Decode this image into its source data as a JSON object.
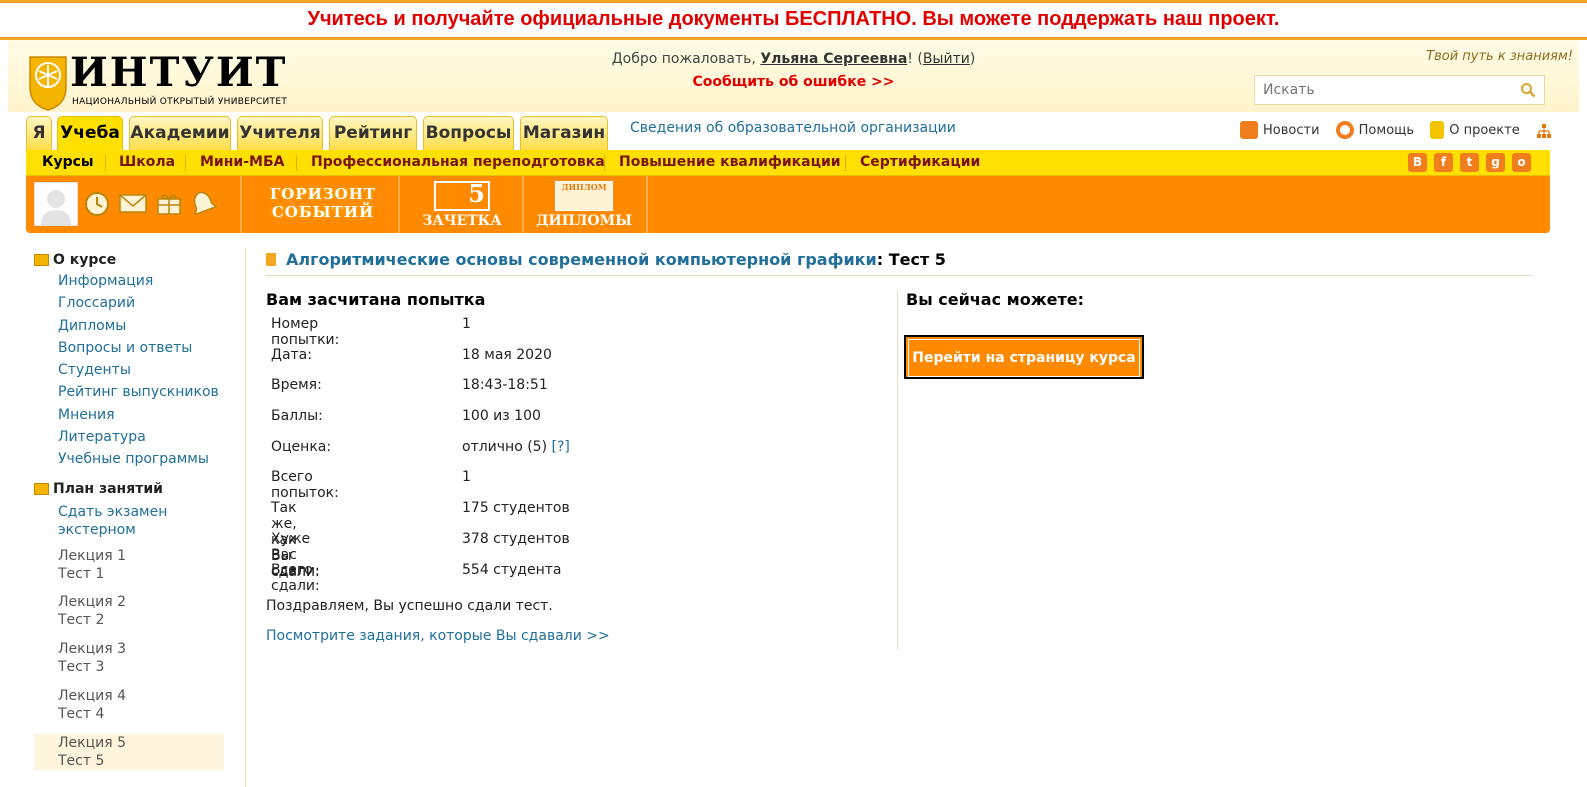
{
  "promo": {
    "text": "Учитесь и получайте официальные документы БЕСПЛАТНО. Вы можете поддержать наш проект."
  },
  "header": {
    "logo_title": "ИНТУИТ",
    "logo_subtitle": "НАЦИОНАЛЬНЫЙ ОТКРЫТЫЙ УНИВЕРСИТЕТ",
    "welcome_prefix": "Добро пожаловать, ",
    "user_name": "Ульяна Сергеевна",
    "welcome_excl": "! (",
    "exit_label": "Выйти",
    "welcome_close": ")",
    "report_error": "Сообщить об ошибке >>",
    "tagline": "Твой путь к знаниям!",
    "search_placeholder": "Искать"
  },
  "tabs": [
    {
      "label": "Я"
    },
    {
      "label": "Учеба",
      "active": true
    },
    {
      "label": "Академии"
    },
    {
      "label": "Учителя"
    },
    {
      "label": "Рейтинг"
    },
    {
      "label": "Вопросы"
    },
    {
      "label": "Магазин"
    }
  ],
  "info_link": "Сведения об образовательной организации",
  "right_links": {
    "news": "Новости",
    "help": "Помощь",
    "about": "О проекте"
  },
  "submenu": [
    "Курсы",
    "Школа",
    "Мини-МБА",
    "Профессиональная переподготовка",
    "Повышение квалификации",
    "Сертификации"
  ],
  "social": [
    "В",
    "f",
    "t",
    "g",
    "о"
  ],
  "toolbar": {
    "horizon_line1": "ГОРИЗОНТ",
    "horizon_line2": "СОБЫТИЙ",
    "zachetka": "ЗАЧЕТКА",
    "zachetka_num": "5",
    "diplomy": "ДИПЛОМЫ",
    "diplom_small": "ДИПЛОМ"
  },
  "sidebar": {
    "about_title": "О курсе",
    "about_links": [
      "Информация",
      "Глоссарий",
      "Дипломы",
      "Вопросы и ответы",
      "Студенты",
      "Рейтинг выпускников",
      "Мнения",
      "Литература",
      "Учебные программы"
    ],
    "plan_title": "План занятий",
    "exam_line1": "Сдать экзамен",
    "exam_line2": "экстерном",
    "lessons": [
      {
        "lecture": "Лекция 1",
        "test": "Тест 1"
      },
      {
        "lecture": "Лекция 2",
        "test": "Тест 2"
      },
      {
        "lecture": "Лекция 3",
        "test": "Тест 3"
      },
      {
        "lecture": "Лекция 4",
        "test": "Тест 4"
      },
      {
        "lecture": "Лекция 5",
        "test": "Тест 5"
      }
    ]
  },
  "main": {
    "course_name": "Алгоритмические основы современной компьютерной графики",
    "test_name": ": Тест 5",
    "result_heading": "Вам засчитана попытка",
    "rows": [
      {
        "label": "Номер попытки:",
        "value": "1"
      },
      {
        "label": "Дата:",
        "value": "18 мая 2020"
      },
      {
        "label": "Время:",
        "value": "18:43-18:51"
      },
      {
        "label": "Баллы:",
        "value": "100 из 100"
      },
      {
        "label": "Оценка:",
        "value": "отлично (5)",
        "extra": "[?]"
      },
      {
        "label": "Всего попыток:",
        "value": "1"
      },
      {
        "label": "Так же, как Вы сдали:",
        "value": "175 студентов"
      },
      {
        "label": "Хуже Вас сдали:",
        "value": "378 студентов"
      },
      {
        "label": "Всего сдали:",
        "value": "554 студента"
      }
    ],
    "congrats": "Поздравляем, Вы успешно сдали тест.",
    "view_tasks": "Посмотрите задания, которые Вы сдавали >>",
    "now_heading": "Вы сейчас можете:",
    "go_course_button": "Перейти на страницу курса"
  },
  "colors": {
    "accent": "#ff8a00",
    "menu_yellow": "#ffe000",
    "link": "#1f6f9a",
    "alert": "#e00000"
  }
}
